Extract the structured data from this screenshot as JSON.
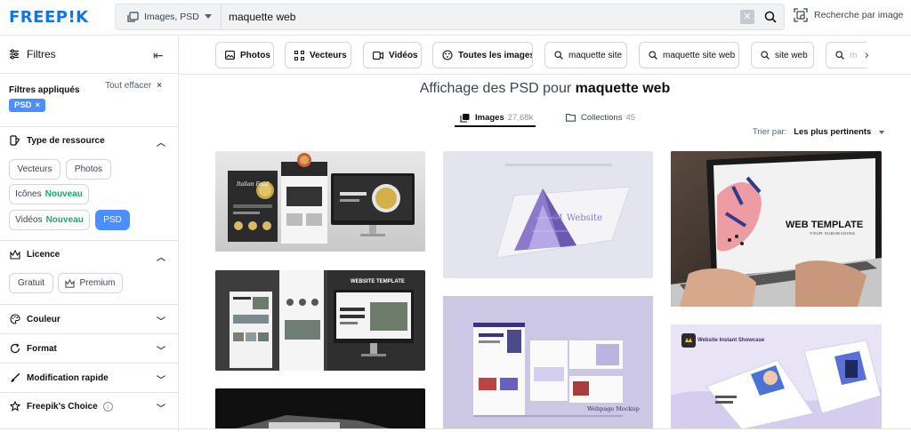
{
  "header": {
    "logo": "FREEP!K",
    "type_select": {
      "label": "Images, PSD",
      "icon": "image-stack-icon"
    },
    "search": {
      "value": "maquette web",
      "placeholder": ""
    },
    "image_search_label": "Recherche par image"
  },
  "sidebar": {
    "title": "Filtres",
    "applied_label": "Filtres appliqués",
    "clear_all_label": "Tout effacer",
    "applied_chip": "PSD",
    "sections": {
      "resource_type": {
        "title": "Type de ressource",
        "icon": "palette-icon",
        "options": {
          "vectors": "Vecteurs",
          "photos": "Photos",
          "icons": "Icônes",
          "videos": "Vidéos",
          "psd": "PSD",
          "new_badge": "Nouveau"
        }
      },
      "license": {
        "title": "Licence",
        "icon": "crown-icon",
        "options": {
          "free": "Gratuit",
          "premium": "Premium"
        }
      },
      "color": {
        "title": "Couleur",
        "icon": "color-palette-icon"
      },
      "format": {
        "title": "Format",
        "icon": "refresh-icon"
      },
      "quick_edit": {
        "title": "Modification rapide",
        "icon": "brush-icon"
      },
      "freepiks_choice": {
        "title": "Freepik's Choice",
        "icon": "star-icon"
      }
    }
  },
  "quick_filters": {
    "photos": "Photos",
    "vectors": "Vecteurs",
    "videos": "Vidéos",
    "all_images": "Toutes les images",
    "suggestions": [
      "maquette site",
      "maquette site web",
      "site web",
      "m"
    ]
  },
  "results": {
    "title_prefix": "Affichage des PSD pour",
    "title_query": "maquette web",
    "tabs": {
      "images": {
        "label": "Images",
        "count": "27,68k"
      },
      "collections": {
        "label": "Collections",
        "count": "45"
      }
    },
    "sort_label": "Trier par:",
    "sort_value": "Les plus pertinents"
  },
  "thumbnails": {
    "t2_text": "Italian Food",
    "t3_text": "01 Website",
    "t4_text": "WEB TEMPLATE",
    "t4_sub": "YOUR SUBHEADING",
    "t5_text": "WEBSITE TEMPLATE",
    "t6_text": "Webpage Mockup",
    "t7_text": "Website Instant Showcase"
  },
  "colors": {
    "brand_blue": "#1273eb",
    "active_chip": "#4c8dff",
    "new_green": "#1aa86a"
  }
}
